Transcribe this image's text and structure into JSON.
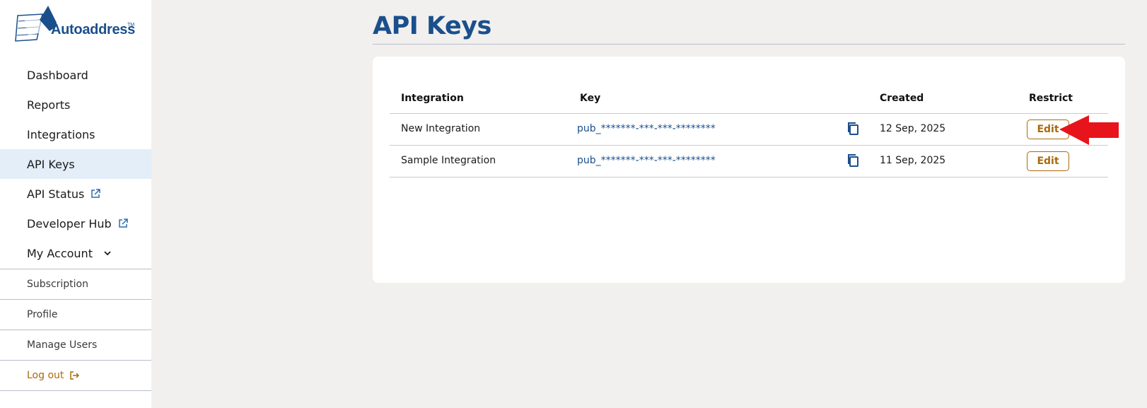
{
  "brand": {
    "name": "Autoaddress",
    "tm": "TM",
    "color": "#1b4f8c"
  },
  "sidebar": {
    "items": [
      {
        "label": "Dashboard"
      },
      {
        "label": "Reports"
      },
      {
        "label": "Integrations"
      },
      {
        "label": "API Keys",
        "active": true
      },
      {
        "label": "API Status",
        "icon": "external-link-icon"
      },
      {
        "label": "Developer Hub",
        "icon": "external-link-icon"
      },
      {
        "label": "My Account",
        "icon": "chevron-down-icon"
      }
    ],
    "submenu": [
      {
        "label": "Subscription"
      },
      {
        "label": "Profile"
      },
      {
        "label": "Manage Users"
      },
      {
        "label": "Log out",
        "icon": "logout-icon"
      }
    ]
  },
  "main": {
    "title": "API Keys",
    "table": {
      "headers": {
        "integration": "Integration",
        "key": "Key",
        "created": "Created",
        "restrict": "Restrict"
      },
      "rows": [
        {
          "integration": "New Integration",
          "key": "pub_*******-***-***-********",
          "created": "12 Sep, 2025",
          "action": "Edit"
        },
        {
          "integration": "Sample Integration",
          "key": "pub_*******-***-***-********",
          "created": "11 Sep, 2025",
          "action": "Edit"
        }
      ]
    }
  },
  "colors": {
    "accent": "#1b4f8c",
    "action": "#a86a0a",
    "annotation_arrow": "#e8141c",
    "active_nav": "#e3eef8"
  }
}
